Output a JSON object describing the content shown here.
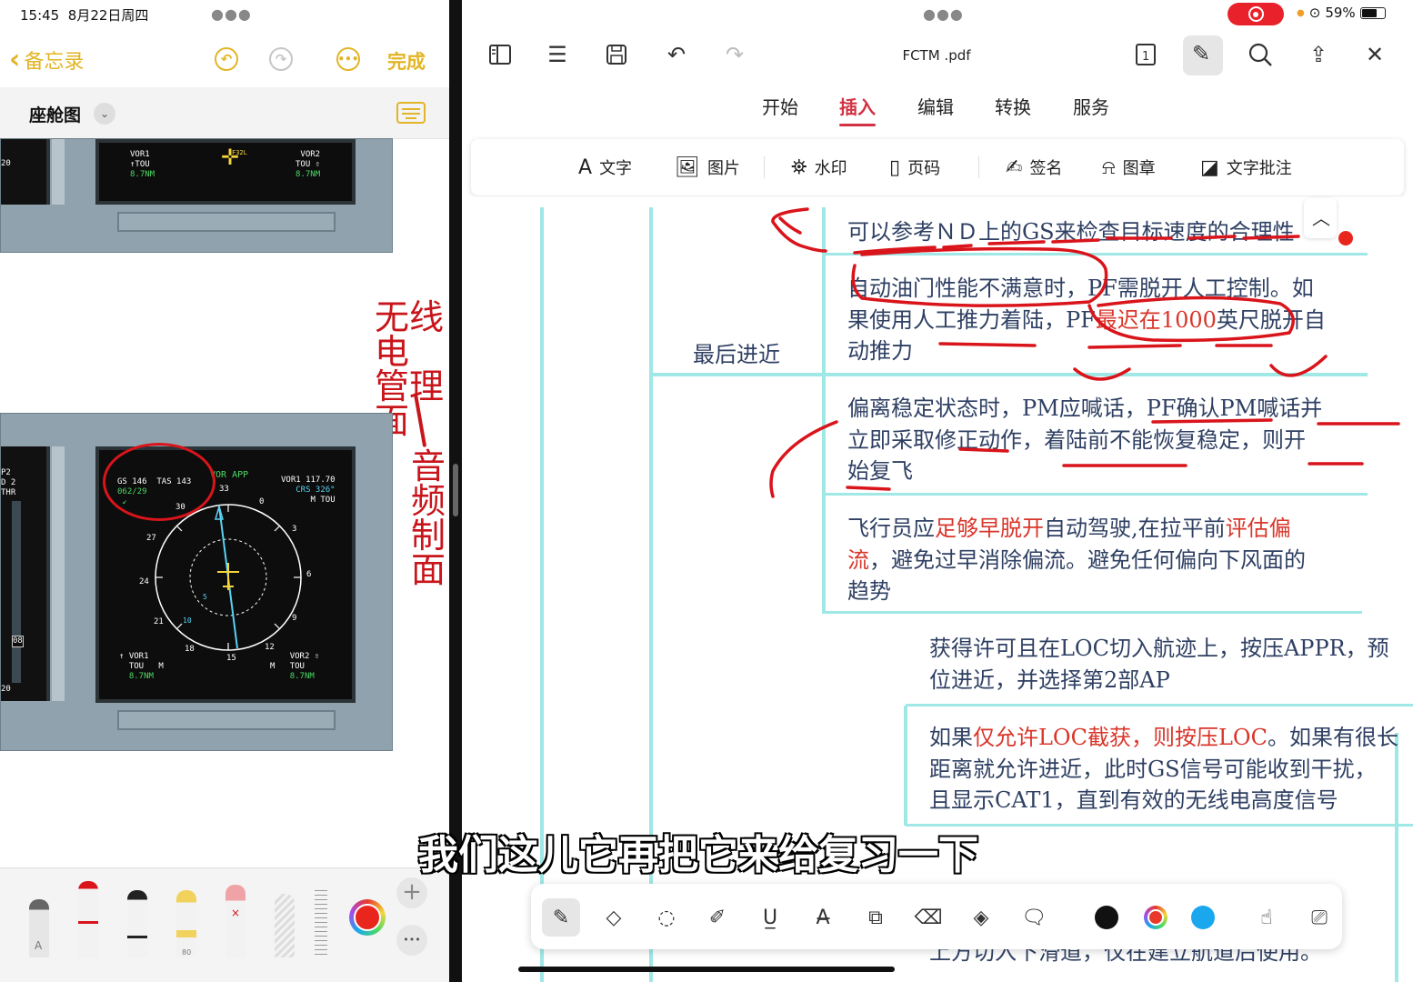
{
  "notes": {
    "status": {
      "time": "15:45",
      "date": "8月22日周四"
    },
    "nav": {
      "back_label": "备忘录",
      "done_label": "完成"
    },
    "title": "座舱图",
    "cockpit_top": {
      "left_display": {
        "vor_label": "VOR1",
        "mode": "TOU",
        "dist": "8.7NM",
        "rwy": "F32L"
      },
      "right_display": {
        "vor_label": "VOR2",
        "mode": "TOU",
        "dist": "8.7NM"
      },
      "edge_num": "20"
    },
    "cockpit_bottom": {
      "edge_lines": [
        "P2",
        "D 2",
        "THR",
        "20",
        "08"
      ],
      "gs": "GS 146",
      "tas": "TAS 143",
      "wind": "062/29",
      "mode": "VOR APP",
      "vor1_freq": "VOR1 117.70",
      "crs": "CRS 326°",
      "tou": "M TOU",
      "hdg_marks": [
        "33",
        "0",
        "3",
        "6",
        "9",
        "12",
        "15",
        "18",
        "21",
        "24",
        "27",
        "30"
      ],
      "range_inner": "5",
      "range_outer": "10",
      "bl_vor": "VOR1",
      "bl_mode": "TOU",
      "bl_m": "M",
      "bl_dist": "8.7NM",
      "br_vor": "VOR2",
      "br_mode": "TOU",
      "br_m": "M",
      "br_dist": "8.7NM"
    },
    "handwriting": {
      "line1": "无线电",
      "line2": "管理面",
      "line3": "音频",
      "line4": "制面"
    },
    "tools": {
      "ruler_label": "80"
    }
  },
  "pdf": {
    "filename": "FCTM .pdf",
    "battery_text": "59%",
    "tabs": [
      "开始",
      "插入",
      "编辑",
      "转换",
      "服务"
    ],
    "active_tab": "插入",
    "ribbon": {
      "text": "文字",
      "image": "图片",
      "watermark": "水印",
      "pagenum": "页码",
      "sign": "签名",
      "stamp": "图章",
      "annot": "文字批注"
    },
    "mindmap": {
      "branch_label": "最后进近",
      "b1": "可以参考ＮＤ上的GS来检查目标速度的合理性",
      "b2_l1_a": "自动油门性能不满意时，PF需脱开人工控制。如",
      "b2_l2_a": "果使用人工推力着陆，PF",
      "b2_l2_red": "最迟在1000",
      "b2_l2_b": "英尺脱开自",
      "b2_l3": "动推力",
      "b3_l1": "偏离稳定状态时，PM应喊话，PF确认PM喊话并",
      "b3_l2": "立即采取修正动作，着陆前不能恢复稳定，则开",
      "b3_l3": "始复飞",
      "b4_l1_a": "飞行员应",
      "b4_l1_red1": "足够早脱开",
      "b4_l1_b": "自动驾驶,在拉平前",
      "b4_l1_red2": "评估偏",
      "b4_l2_red": "流",
      "b4_l2_b": "，避免过早消除偏流。避免任何偏向下风面的",
      "b4_l3": "趋势",
      "c1_l1": "获得许可且在LOC切入航迹上，按压APPR，预",
      "c1_l2": "位进近，并选择第2部AP",
      "c2_l1_a": "如果",
      "c2_l1_red": "仅允许LOC截获，则按压LOC",
      "c2_l1_b": "。如果有很长",
      "c2_l2": "距离就允许进近，此时GS信号可能收到干扰，",
      "c2_l3": "且显示CAT1，直到有效的无线电高度信号",
      "c3_partial": "上方切入下滑道，仅在建立航道后使用。"
    },
    "subtitle": "我们这儿它再把它来给复习一下",
    "draw_colors": {
      "black": "#111111",
      "red": "#e8392c",
      "blue": "#1aa7ee"
    }
  }
}
